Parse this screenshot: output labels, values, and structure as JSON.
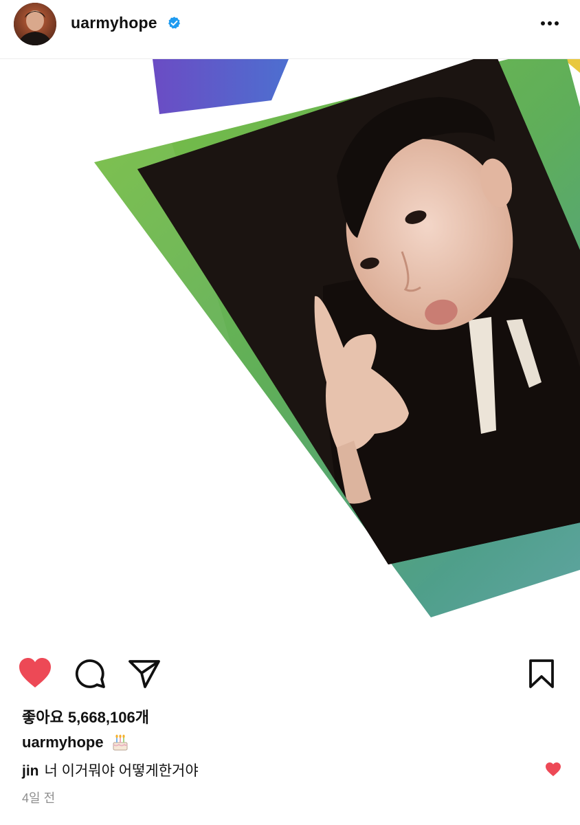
{
  "header": {
    "username": "uarmyhope",
    "verified": true,
    "avatar_icon": "profile-avatar",
    "more_icon": "more-horizontal-icon"
  },
  "post": {
    "image_description_icon": "polaroid-photo",
    "liked": true
  },
  "actions": {
    "like_icon": "heart-filled-icon",
    "comment_icon": "comment-icon",
    "share_icon": "send-icon",
    "save_icon": "bookmark-icon"
  },
  "likes": {
    "text": "좋아요 5,668,106개"
  },
  "caption": {
    "username": "uarmyhope",
    "emoji_icon": "birthday-cake-icon"
  },
  "comment": {
    "username": "jin",
    "text": "너 이거뭐야 어떻게한거야",
    "liked": true
  },
  "timestamp": "4일 전",
  "colors": {
    "like_red": "#ed4956",
    "verified_blue": "#1f9bf0",
    "muted_text": "#8e8e8e"
  }
}
